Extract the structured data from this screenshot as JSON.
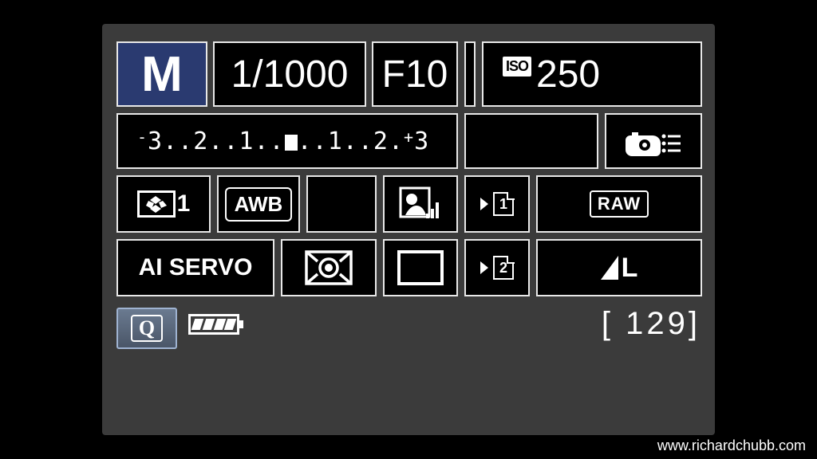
{
  "mode": "M",
  "shutter": "1/1000",
  "aperture": "F10",
  "iso_label": "ISO",
  "iso_value": "250",
  "exposure_comp": "‑3..2..1..⦿..1..2.⁺3",
  "picture_style_num": "1",
  "white_balance": "AWB",
  "af_mode": "AI SERVO",
  "card1": "1",
  "card2": "2",
  "raw_label": "RAW",
  "jpeg_size": "L",
  "q_label": "Q",
  "shots_remaining_open": "[",
  "shots_remaining": "  129",
  "shots_remaining_close": "]",
  "watermark": "www.richardchubb.com"
}
